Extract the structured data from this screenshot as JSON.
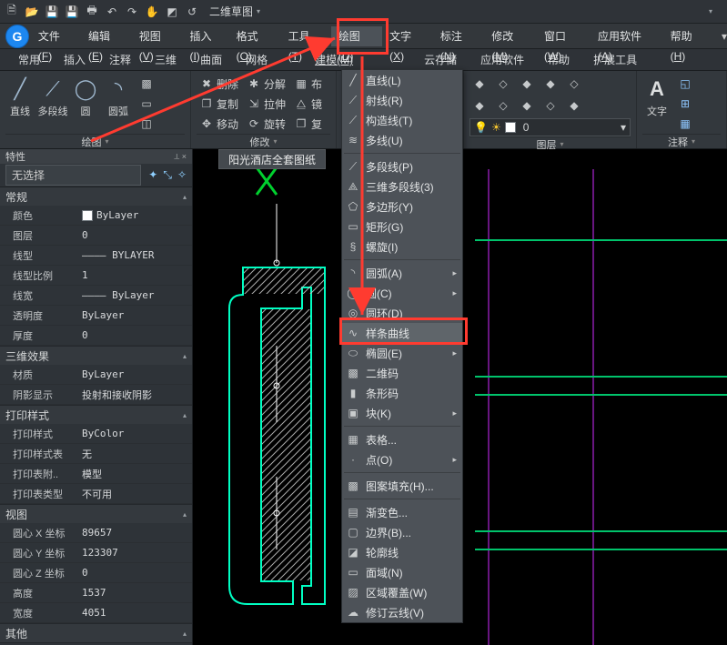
{
  "qat": {
    "workspace": "二维草图"
  },
  "menubar": {
    "items": [
      {
        "label": "文件",
        "key": "F"
      },
      {
        "label": "编辑",
        "key": "E"
      },
      {
        "label": "视图",
        "key": "V"
      },
      {
        "label": "插入",
        "key": "I"
      },
      {
        "label": "格式",
        "key": "O"
      },
      {
        "label": "工具",
        "key": "T"
      },
      {
        "label": "绘图",
        "key": "D"
      },
      {
        "label": "文字",
        "key": "X"
      },
      {
        "label": "标注",
        "key": "N"
      },
      {
        "label": "修改",
        "key": "M"
      },
      {
        "label": "窗口",
        "key": "W"
      },
      {
        "label": "应用软件",
        "key": "A"
      },
      {
        "label": "帮助",
        "key": "H"
      }
    ]
  },
  "tabs": [
    "常用",
    "插入",
    "注释",
    "三维",
    "曲面",
    "网格",
    "",
    "建模",
    "",
    "",
    "云存储",
    "应用软件",
    "帮助",
    "扩展工具"
  ],
  "tabs_modeling_label": "建模(M)",
  "ribbon": {
    "panel1": {
      "title": "绘图",
      "big": [
        {
          "label": "直线",
          "name": "line"
        },
        {
          "label": "多段线",
          "name": "pline"
        },
        {
          "label": "圆",
          "name": "circle"
        },
        {
          "label": "圆弧",
          "name": "arc"
        }
      ]
    },
    "panel2": {
      "title": "修改",
      "rows": [
        {
          "label": "删除",
          "name": "erase"
        },
        {
          "label": "复制",
          "name": "copy"
        },
        {
          "label": "移动",
          "name": "move"
        },
        {
          "label": "分解",
          "name": "explode"
        },
        {
          "label": "拉伸",
          "name": "stretch"
        },
        {
          "label": "旋转",
          "name": "rotate"
        },
        {
          "label": "布",
          "name": "array"
        },
        {
          "label": "镜",
          "name": "mirror"
        },
        {
          "label": "复",
          "name": "copy2"
        }
      ]
    },
    "panel_layers": {
      "title": "图层"
    },
    "panel_annot": {
      "title": "注释",
      "big": "文字"
    }
  },
  "props": {
    "title": "特性",
    "selection": "无选择",
    "groups": [
      {
        "name": "常规",
        "rows": [
          {
            "k": "颜色",
            "v": "ByLayer",
            "chip": "#ffffff"
          },
          {
            "k": "图层",
            "v": "0"
          },
          {
            "k": "线型",
            "v": "———— BYLAYER"
          },
          {
            "k": "线型比例",
            "v": "1"
          },
          {
            "k": "线宽",
            "v": "———— ByLayer"
          },
          {
            "k": "透明度",
            "v": "ByLayer"
          },
          {
            "k": "厚度",
            "v": "0"
          }
        ]
      },
      {
        "name": "三维效果",
        "rows": [
          {
            "k": "材质",
            "v": "ByLayer"
          },
          {
            "k": "阴影显示",
            "v": "投射和接收阴影"
          }
        ]
      },
      {
        "name": "打印样式",
        "rows": [
          {
            "k": "打印样式",
            "v": "ByColor"
          },
          {
            "k": "打印样式表",
            "v": "无"
          },
          {
            "k": "打印表附..",
            "v": "模型"
          },
          {
            "k": "打印表类型",
            "v": "不可用"
          }
        ]
      },
      {
        "name": "视图",
        "rows": [
          {
            "k": "圆心 X 坐标",
            "v": "89657"
          },
          {
            "k": "圆心 Y 坐标",
            "v": "123307"
          },
          {
            "k": "圆心 Z 坐标",
            "v": "0"
          },
          {
            "k": "高度",
            "v": "1537"
          },
          {
            "k": "宽度",
            "v": "4051"
          }
        ]
      },
      {
        "name": "其他",
        "rows": []
      }
    ]
  },
  "document_tab": "阳光酒店全套图纸",
  "draw_menu": {
    "items": [
      {
        "t": "直线(L)",
        "g": "line"
      },
      {
        "t": "射线(R)",
        "g": "ray"
      },
      {
        "t": "构造线(T)",
        "g": "xline"
      },
      {
        "t": "多线(U)",
        "g": "mline"
      },
      {
        "sep": true
      },
      {
        "t": "多段线(P)",
        "g": "pl"
      },
      {
        "t": "三维多段线(3)",
        "g": "pl3"
      },
      {
        "t": "多边形(Y)",
        "g": "poly"
      },
      {
        "t": "矩形(G)",
        "g": "rect"
      },
      {
        "t": "螺旋(I)",
        "g": "helix"
      },
      {
        "sep": true
      },
      {
        "t": "圆弧(A)",
        "g": "arc",
        "sub": true
      },
      {
        "t": "圆(C)",
        "g": "circ",
        "sub": true
      },
      {
        "t": "圆环(D)",
        "g": "donut"
      },
      {
        "t": "样条曲线",
        "g": "spline",
        "hl": true
      },
      {
        "t": "椭圆(E)",
        "g": "ell",
        "sub": true
      },
      {
        "t": "二维码",
        "g": "qr"
      },
      {
        "t": "条形码",
        "g": "bar"
      },
      {
        "t": "块(K)",
        "g": "block",
        "sub": true
      },
      {
        "sep": true
      },
      {
        "t": "表格...",
        "g": "table"
      },
      {
        "t": "点(O)",
        "g": "point",
        "sub": true
      },
      {
        "sep": true
      },
      {
        "t": "图案填充(H)...",
        "g": "hatch"
      },
      {
        "sep": true
      },
      {
        "t": "渐变色...",
        "g": "grad"
      },
      {
        "t": "边界(B)...",
        "g": "bound"
      },
      {
        "t": "轮廓线",
        "g": "sil"
      },
      {
        "t": "面域(N)",
        "g": "region"
      },
      {
        "t": "区域覆盖(W)",
        "g": "wipe"
      },
      {
        "t": "修订云线(V)",
        "g": "revc"
      }
    ]
  }
}
